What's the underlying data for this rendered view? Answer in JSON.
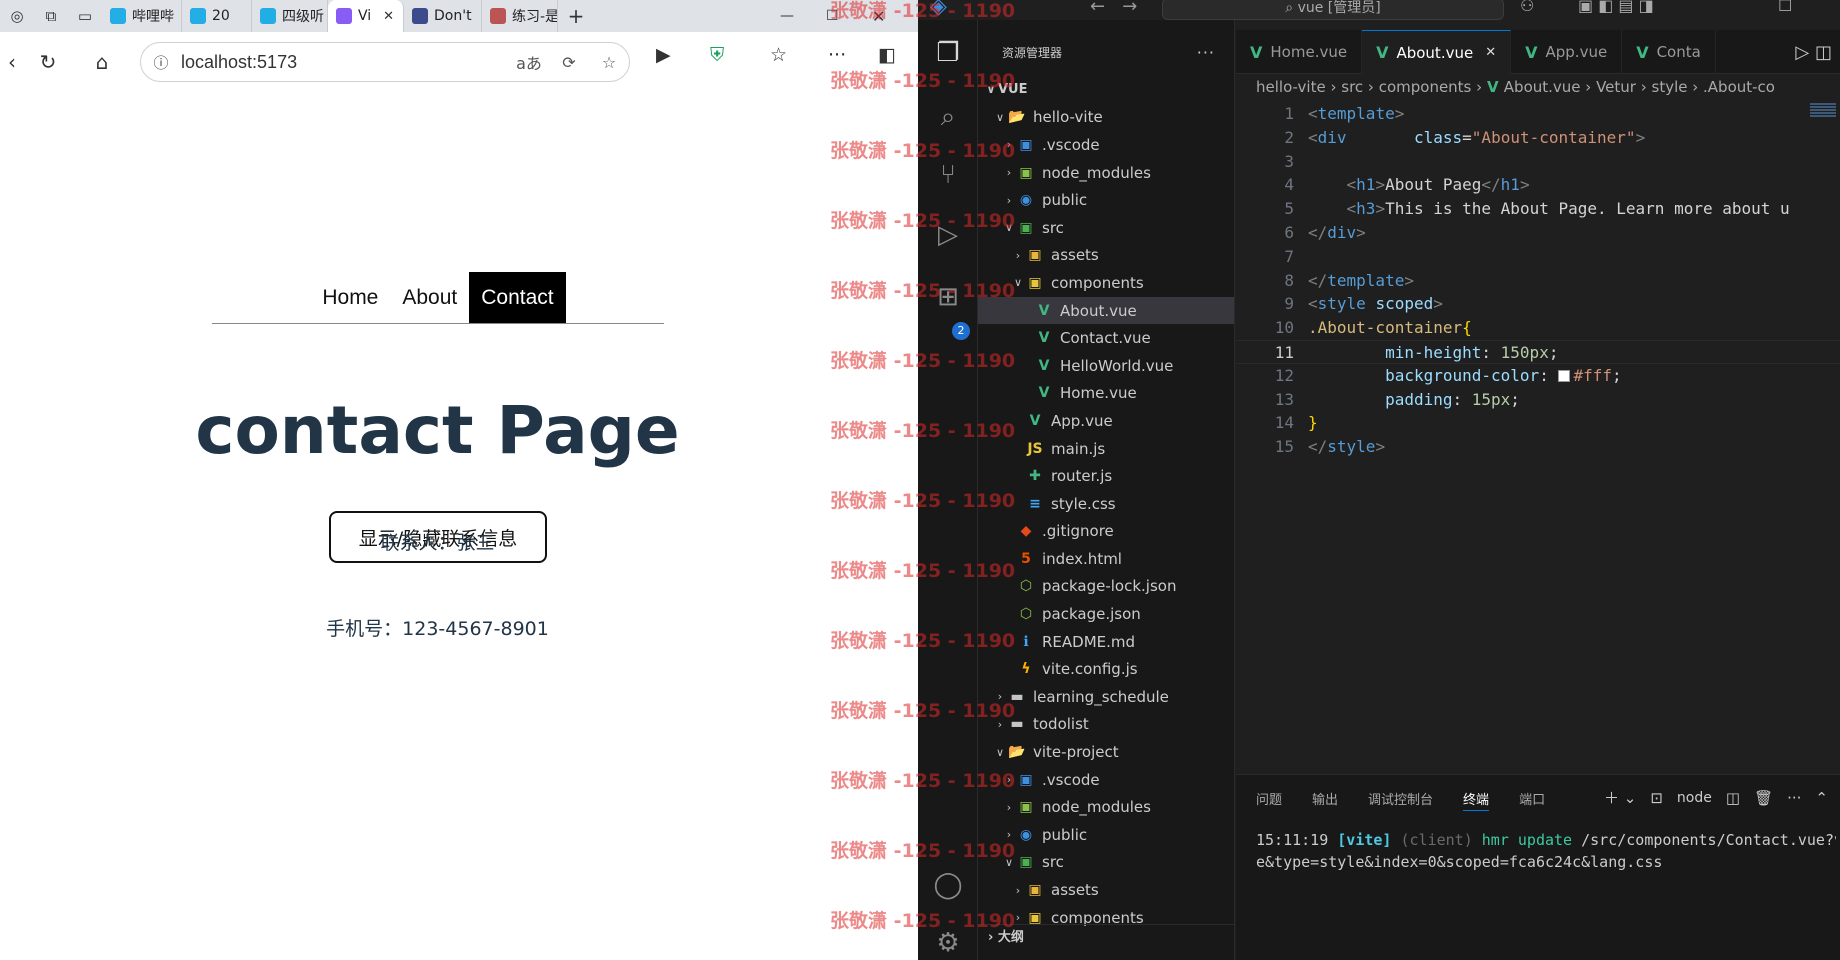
{
  "browser": {
    "tabs": [
      {
        "label": "哔哩哔",
        "icon": "bilibili-icon",
        "color": "#23ade5"
      },
      {
        "label": "20",
        "icon": "bilibili-icon",
        "color": "#23ade5"
      },
      {
        "label": "四级听",
        "icon": "bilibili-icon",
        "color": "#23ade5"
      },
      {
        "label": "Vi",
        "icon": "vite-icon",
        "color": "#8a5cf6",
        "active": true
      },
      {
        "label": "Don't",
        "icon": "page-icon",
        "color": "#3b4b8c"
      },
      {
        "label": "练习-是",
        "icon": "image-icon",
        "color": "#b55"
      }
    ],
    "url": "localhost:5173",
    "url_placeholder": "localhost:5173"
  },
  "page": {
    "nav": [
      {
        "label": "Home"
      },
      {
        "label": "About"
      },
      {
        "label": "Contact",
        "active": true
      }
    ],
    "title": "contact Page",
    "toggle_button": "显示/隐藏联系信息",
    "contact_person": "联系人：张三",
    "phone": "手机号：123-4567-8901"
  },
  "vscode": {
    "command_center": "vue [管理员]",
    "activity_badge": "2",
    "explorer_title": "资源管理器",
    "explorer_more": "···",
    "outline_label": "大纲",
    "tree": [
      {
        "label": "VUE",
        "depth": 0,
        "chev": "∨",
        "icon": "",
        "bold": true
      },
      {
        "label": "hello-vite",
        "depth": 1,
        "chev": "∨",
        "icon": "📂",
        "color": "#c5c5c5"
      },
      {
        "label": ".vscode",
        "depth": 2,
        "chev": "›",
        "icon": "▣",
        "color": "#3d8fe0"
      },
      {
        "label": "node_modules",
        "depth": 2,
        "chev": "›",
        "icon": "▣",
        "color": "#8bc34a"
      },
      {
        "label": "public",
        "depth": 2,
        "chev": "›",
        "icon": "◉",
        "color": "#3d8fe0"
      },
      {
        "label": "src",
        "depth": 2,
        "chev": "∨",
        "icon": "▣",
        "color": "#4caf50"
      },
      {
        "label": "assets",
        "depth": 3,
        "chev": "›",
        "icon": "▣",
        "color": "#e8b43a"
      },
      {
        "label": "components",
        "depth": 3,
        "chev": "∨",
        "icon": "▣",
        "color": "#e8c53a"
      },
      {
        "label": "About.vue",
        "depth": 4,
        "chev": "",
        "icon": "V",
        "color": "#41b883",
        "selected": true
      },
      {
        "label": "Contact.vue",
        "depth": 4,
        "chev": "",
        "icon": "V",
        "color": "#41b883"
      },
      {
        "label": "HelloWorld.vue",
        "depth": 4,
        "chev": "",
        "icon": "V",
        "color": "#41b883"
      },
      {
        "label": "Home.vue",
        "depth": 4,
        "chev": "",
        "icon": "V",
        "color": "#41b883"
      },
      {
        "label": "App.vue",
        "depth": 3,
        "chev": "",
        "icon": "V",
        "color": "#41b883"
      },
      {
        "label": "main.js",
        "depth": 3,
        "chev": "",
        "icon": "JS",
        "color": "#e8c53a"
      },
      {
        "label": "router.js",
        "depth": 3,
        "chev": "",
        "icon": "✚",
        "color": "#41b883"
      },
      {
        "label": "style.css",
        "depth": 3,
        "chev": "",
        "icon": "≡",
        "color": "#42a5f5"
      },
      {
        "label": ".gitignore",
        "depth": 2,
        "chev": "",
        "icon": "◆",
        "color": "#e64a19"
      },
      {
        "label": "index.html",
        "depth": 2,
        "chev": "",
        "icon": "5",
        "color": "#e65100"
      },
      {
        "label": "package-lock.json",
        "depth": 2,
        "chev": "",
        "icon": "⬡",
        "color": "#8bc34a"
      },
      {
        "label": "package.json",
        "depth": 2,
        "chev": "",
        "icon": "⬡",
        "color": "#8bc34a"
      },
      {
        "label": "README.md",
        "depth": 2,
        "chev": "",
        "icon": "ℹ",
        "color": "#42a5f5"
      },
      {
        "label": "vite.config.js",
        "depth": 2,
        "chev": "",
        "icon": "ϟ",
        "color": "#ffb300"
      },
      {
        "label": "learning_schedule",
        "depth": 1,
        "chev": "›",
        "icon": "▬",
        "color": "#c5c5c5"
      },
      {
        "label": "todolist",
        "depth": 1,
        "chev": "›",
        "icon": "▬",
        "color": "#c5c5c5"
      },
      {
        "label": "vite-project",
        "depth": 1,
        "chev": "∨",
        "icon": "📂",
        "color": "#c5c5c5"
      },
      {
        "label": ".vscode",
        "depth": 2,
        "chev": "›",
        "icon": "▣",
        "color": "#3d8fe0"
      },
      {
        "label": "node_modules",
        "depth": 2,
        "chev": "›",
        "icon": "▣",
        "color": "#8bc34a"
      },
      {
        "label": "public",
        "depth": 2,
        "chev": "›",
        "icon": "◉",
        "color": "#3d8fe0"
      },
      {
        "label": "src",
        "depth": 2,
        "chev": "∨",
        "icon": "▣",
        "color": "#4caf50"
      },
      {
        "label": "assets",
        "depth": 3,
        "chev": "›",
        "icon": "▣",
        "color": "#e8b43a"
      },
      {
        "label": "components",
        "depth": 3,
        "chev": "›",
        "icon": "▣",
        "color": "#e8c53a"
      }
    ],
    "editor_tabs": [
      {
        "label": "Home.vue"
      },
      {
        "label": "About.vue",
        "active": true
      },
      {
        "label": "App.vue"
      },
      {
        "label": "Conta"
      }
    ],
    "breadcrumb": [
      "hello-vite",
      "src",
      "components",
      "About.vue",
      "Vetur",
      "style",
      ".About-co"
    ],
    "current_line": 11,
    "code_lines": [
      [
        [
          "t-brk",
          "<"
        ],
        [
          "t-tag",
          "template"
        ],
        [
          "t-brk",
          ">"
        ]
      ],
      [
        [
          "t-brk",
          "<"
        ],
        [
          "t-tag",
          "div"
        ],
        [
          "t-txt",
          "       "
        ],
        [
          "t-attr",
          "class"
        ],
        [
          "t-punc",
          "="
        ],
        [
          "t-str",
          "\"About-container\""
        ],
        [
          "t-brk",
          ">"
        ]
      ],
      [],
      [
        [
          "t-txt",
          "    "
        ],
        [
          "t-brk",
          "<"
        ],
        [
          "t-tag",
          "h1"
        ],
        [
          "t-brk",
          ">"
        ],
        [
          "t-txt",
          "About Paeg"
        ],
        [
          "t-brk",
          "</"
        ],
        [
          "t-tag",
          "h1"
        ],
        [
          "t-brk",
          ">"
        ]
      ],
      [
        [
          "t-txt",
          "    "
        ],
        [
          "t-brk",
          "<"
        ],
        [
          "t-tag",
          "h3"
        ],
        [
          "t-brk",
          ">"
        ],
        [
          "t-txt",
          "This is the About Page. Learn more about u"
        ]
      ],
      [
        [
          "t-brk",
          "</"
        ],
        [
          "t-tag",
          "div"
        ],
        [
          "t-brk",
          ">"
        ]
      ],
      [],
      [
        [
          "t-brk",
          "</"
        ],
        [
          "t-tag",
          "template"
        ],
        [
          "t-brk",
          ">"
        ]
      ],
      [
        [
          "t-brk",
          "<"
        ],
        [
          "t-tag",
          "style"
        ],
        [
          "t-txt",
          " "
        ],
        [
          "t-attr",
          "scoped"
        ],
        [
          "t-brk",
          ">"
        ]
      ],
      [
        [
          "t-sel",
          ".About-container"
        ],
        [
          "t-yel",
          "{"
        ]
      ],
      [
        [
          "t-txt",
          "        "
        ],
        [
          "t-prop",
          "min-height"
        ],
        [
          "t-punc",
          ": "
        ],
        [
          "t-num",
          "150px"
        ],
        [
          "t-punc",
          ";"
        ]
      ],
      [
        [
          "t-txt",
          "        "
        ],
        [
          "t-prop",
          "background-color"
        ],
        [
          "t-punc",
          ": "
        ],
        [
          "swatch",
          ""
        ],
        [
          "t-str",
          "#fff"
        ],
        [
          "t-punc",
          ";"
        ]
      ],
      [
        [
          "t-txt",
          "        "
        ],
        [
          "t-prop",
          "padding"
        ],
        [
          "t-punc",
          ": "
        ],
        [
          "t-num",
          "15px"
        ],
        [
          "t-punc",
          ";"
        ]
      ],
      [
        [
          "t-yel",
          "}"
        ]
      ],
      [
        [
          "t-brk",
          "</"
        ],
        [
          "t-tag",
          "style"
        ],
        [
          "t-brk",
          ">"
        ]
      ]
    ],
    "panel_tabs": [
      {
        "label": "问题"
      },
      {
        "label": "输出"
      },
      {
        "label": "调试控制台"
      },
      {
        "label": "终端",
        "active": true
      },
      {
        "label": "端口"
      }
    ],
    "terminal_profile": "node",
    "terminal": {
      "time": "15:11:19",
      "tag": "[vite]",
      "client": "(client)",
      "hmr": "hmr update",
      "path": "/src/components/Contact.vue?v",
      "line2": "e&type=style&index=0&scoped=fca6c24c&lang.css"
    }
  },
  "watermark": "张敬潇 -125 - 1190"
}
